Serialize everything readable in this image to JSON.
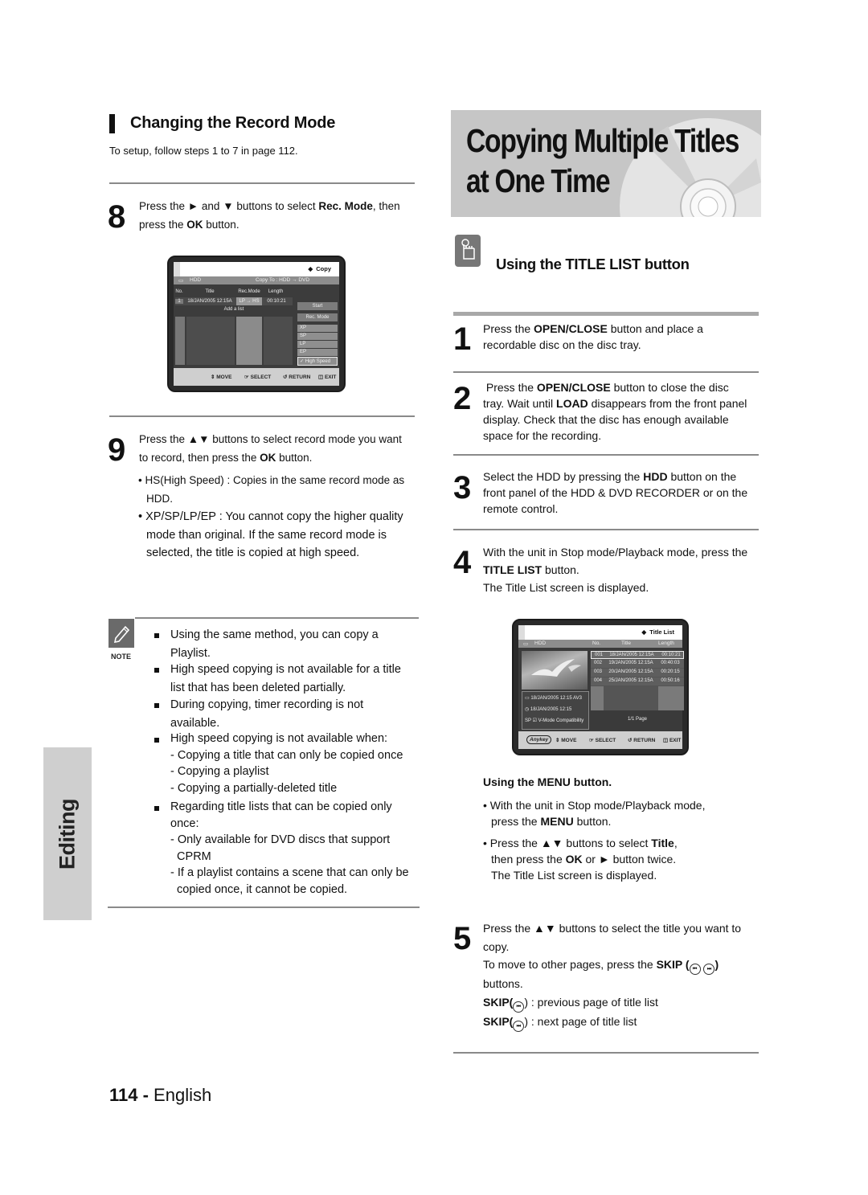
{
  "left": {
    "section_title": "Changing the Record Mode",
    "intro": "To setup, follow steps 1 to 7 in page 112.",
    "step8": {
      "num": "8",
      "pre": "Press the ",
      "arrows1": "►",
      "mid1": " and ",
      "arrows2": "▼",
      "mid2": " buttons to select ",
      "bold1": "Rec. Mode",
      "mid3": ", then",
      "line2a": "press the ",
      "bold2": "OK",
      "line2b": " button."
    },
    "copy_screen": {
      "title": "Copy",
      "source": "HDD",
      "copy_to": "Copy To : HDD → DVD",
      "columns": [
        "No.",
        "Title",
        "Rec.Mode",
        "Length"
      ],
      "row": {
        "no": "1",
        "title": "18/JAN/2005 12:15A",
        "rec_mode": "LP → HS",
        "length": "00:10:21"
      },
      "add_list": "Add a list",
      "start_button": "Start",
      "rec_mode_button": "Rec. Mode",
      "mode_options": [
        "XP",
        "SP",
        "LP",
        "EP",
        "High Speed"
      ],
      "selected_mode": "High Speed",
      "footer": [
        "MOVE",
        "SELECT",
        "RETURN",
        "EXIT"
      ]
    },
    "step9": {
      "num": "9",
      "line1a": "Press the ",
      "arrows": "▲▼",
      "line1b": " buttons to select record mode you want",
      "line2a": "to record, then press the ",
      "bold": "OK",
      "line2b": " button.",
      "bullets": [
        [
          "• HS(High Speed) : Copies in the same record mode as",
          "HDD."
        ],
        [
          "• XP/SP/LP/EP : You cannot copy the higher quality",
          "mode than original. If the same record mode is",
          "selected, the title is copied at high speed."
        ]
      ]
    },
    "note": {
      "label": "NOTE",
      "items": [
        {
          "lines": [
            "Using the same method, you can copy a",
            "Playlist."
          ]
        },
        {
          "lines": [
            "High speed copying is not available for a title",
            "list that has been deleted partially."
          ]
        },
        {
          "lines": [
            "During copying, timer recording is not",
            "available."
          ]
        },
        {
          "lines": [
            "High speed copying is not available when:",
            "- Copying a title that can only be copied once",
            "- Copying a playlist",
            "- Copying a partially-deleted title"
          ]
        },
        {
          "lines": [
            "Regarding title lists that can be copied only",
            "once:",
            "- Only available for DVD discs that support",
            "  CPRM",
            "- If a playlist contains a scene that can only be",
            "  copied once, it cannot be copied."
          ]
        }
      ]
    },
    "side_tab": "Editing",
    "page_number": "114 -",
    "page_lang": " English"
  },
  "right": {
    "banner_line1": "Copying Multiple Titles",
    "banner_line2": "at One Time",
    "subsection": "Using the TITLE LIST button",
    "step1": {
      "num": "1",
      "a": "Press the ",
      "b": "OPEN/CLOSE",
      "c": " button and place a",
      "d": "recordable disc on the disc tray."
    },
    "step2": {
      "num": "2",
      "a": " Press the ",
      "b": "OPEN/CLOSE",
      "c": " button to close the disc",
      "d": "tray. Wait until ",
      "e": "LOAD",
      "f": " disappears from the front panel",
      "g": "display. Check that the disc has enough available",
      "h": "space for the recording."
    },
    "step3": {
      "num": "3",
      "a": "Select the HDD by pressing the ",
      "b": "HDD",
      "c": " button on the",
      "d": "front panel of the HDD & DVD RECORDER or on the",
      "e": "remote control."
    },
    "step4": {
      "num": "4",
      "a": "With the unit in Stop mode/Playback mode, press the",
      "b": "TITLE LIST",
      "c": " button.",
      "d": "The Title List screen is displayed."
    },
    "title_screen": {
      "title": "Title List",
      "source": "HDD",
      "columns": [
        "No.",
        "Title",
        "Length"
      ],
      "rows": [
        {
          "no": "001",
          "title": "18/JAN/2005 12:15A",
          "length": "00:10:21"
        },
        {
          "no": "002",
          "title": "19/JAN/2005 12:15A",
          "length": "00:40:03"
        },
        {
          "no": "003",
          "title": "20/JAN/2005 12:15A",
          "length": "00:20:15"
        },
        {
          "no": "004",
          "title": "25/JAN/2005 12:15A",
          "length": "00:50:16"
        }
      ],
      "info1": "18/JAN/2005 12:15 AV3",
      "info2": "18/JAN/2005 12:15",
      "info3": "SP ☑ V-Mode Compatibility",
      "page": "1/1 Page",
      "anykey": "Anykey",
      "footer": [
        "MOVE",
        "SELECT",
        "RETURN",
        "EXIT"
      ]
    },
    "menu": {
      "heading": "Using the MENU button.",
      "b1a": "• With the unit in Stop mode/Playback mode,",
      "b1b": "press the ",
      "b1c": "MENU",
      "b1d": " button.",
      "b2a": "• Press the ",
      "b2arrows": "▲▼",
      "b2b": " buttons to select ",
      "b2c": "Title",
      "b2d": ",",
      "b2e": "then press the ",
      "b2f": "OK",
      "b2g": " or ► button twice.",
      "b2h": "The Title List screen is displayed."
    },
    "step5": {
      "num": "5",
      "a": "Press the ▲▼ buttons to select the title you want to",
      "b": "copy.",
      "c": "To move to other pages, press the ",
      "d": "SKIP (",
      "e": ")",
      "f": "buttons.",
      "prev_label": "SKIP(",
      "prev_text": ") : previous page of title list",
      "next_label": "SKIP(",
      "next_text": ") : next page of title list",
      "skip_prev_glyph": "⏮",
      "skip_next_glyph": "⏭"
    }
  }
}
